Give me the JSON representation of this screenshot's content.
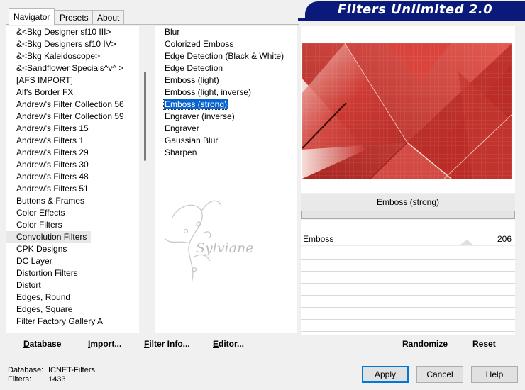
{
  "tabs": [
    "Navigator",
    "Presets",
    "About"
  ],
  "title": "Filters Unlimited 2.0",
  "categories": [
    "&<Bkg Designer sf10 III>",
    "&<Bkg Designers sf10 IV>",
    "&<Bkg Kaleidoscope>",
    "&<Sandflower Specials^v^ >",
    "[AFS IMPORT]",
    "Alf's Border FX",
    "Andrew's Filter Collection 56",
    "Andrew's Filter Collection 59",
    "Andrew's Filters 15",
    "Andrew's Filters 1",
    "Andrew's Filters 29",
    "Andrew's Filters 30",
    "Andrew's Filters 48",
    "Andrew's Filters 51",
    "Buttons & Frames",
    "Color Effects",
    "Color Filters",
    "Convolution Filters",
    "CPK Designs",
    "DC Layer",
    "Distortion Filters",
    "Distort",
    "Edges, Round",
    "Edges, Square",
    "Filter Factory Gallery A"
  ],
  "selected_category": "Convolution Filters",
  "filters": [
    "Blur",
    "Colorized Emboss",
    "Edge Detection (Black & White)",
    "Edge Detection",
    "Emboss (light)",
    "Emboss (light, inverse)",
    "Emboss (strong)",
    "Engraver (inverse)",
    "Engraver",
    "Gaussian Blur",
    "Sharpen"
  ],
  "selected_filter": "Emboss (strong)",
  "watermark_text": "Sylviane",
  "preview": {
    "filter_name": "Emboss (strong)",
    "colors": {
      "base": "#c8302c",
      "light": "#f4cfc8",
      "dark": "#8e1a18",
      "shadow": "#2a0605"
    }
  },
  "params": [
    {
      "label": "Emboss",
      "value": "206",
      "level": 206,
      "max": 255
    }
  ],
  "toolbar": {
    "database": {
      "u": "D",
      "rest": "atabase"
    },
    "import": {
      "u": "I",
      "rest": "mport..."
    },
    "filter_info": {
      "u": "F",
      "rest": "ilter Info..."
    },
    "editor": {
      "u": "E",
      "rest": "ditor..."
    },
    "randomize": "Randomize",
    "reset": "Reset"
  },
  "status": {
    "database_label": "Database:",
    "database_value": "ICNET-Filters",
    "filters_label": "Filters:",
    "filters_value": "1433"
  },
  "buttons": {
    "apply": "Apply",
    "cancel": "Cancel",
    "help": "Help"
  },
  "accent_color": "#0a1a7a",
  "selection_color": "#0a64d0"
}
